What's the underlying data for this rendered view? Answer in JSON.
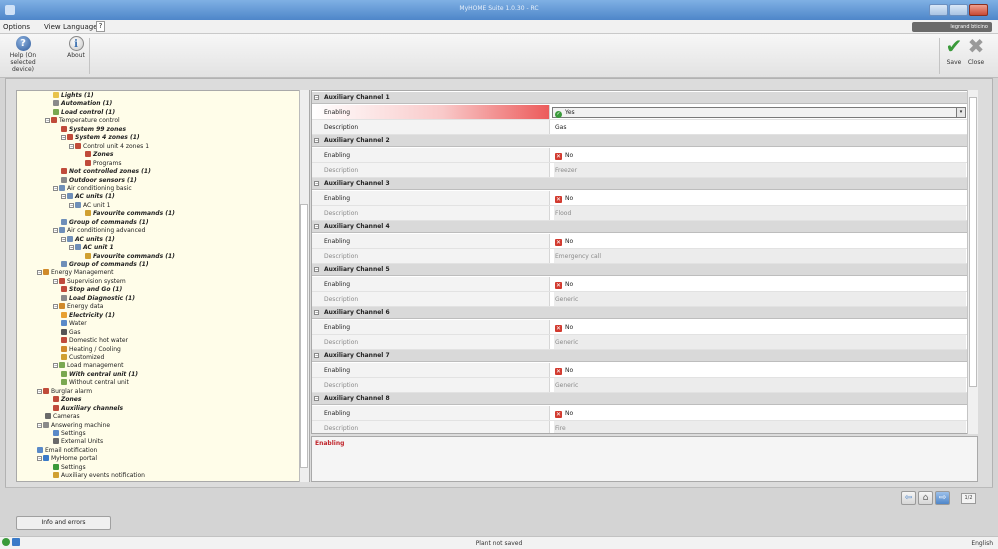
{
  "window": {
    "title": "MyHOME Suite 1.0.30 - RC"
  },
  "menu": {
    "items": [
      "Options",
      "View",
      "Language"
    ],
    "help": "?"
  },
  "brand": "legrand bticino",
  "toolbar": {
    "help_label_1": "Help (On",
    "help_label_2": "selected device)",
    "about_label": "About",
    "save_label": "Save",
    "close_label": "Close"
  },
  "tree": [
    {
      "label": "Lights (1)",
      "indent": 5,
      "bold": true,
      "icon": "#e8c34a"
    },
    {
      "label": "Automation (1)",
      "indent": 5,
      "bold": true,
      "icon": "#8a8a8a"
    },
    {
      "label": "Load control (1)",
      "indent": 5,
      "bold": true,
      "icon": "#7aa850"
    },
    {
      "label": "Temperature control",
      "indent": 4,
      "bold": false,
      "icon": "#c04b3a",
      "toggle": "−"
    },
    {
      "label": "System 99 zones",
      "indent": 6,
      "bold": true,
      "icon": "#c04b3a"
    },
    {
      "label": "System 4 zones (1)",
      "indent": 6,
      "bold": true,
      "icon": "#c04b3a",
      "toggle": "−"
    },
    {
      "label": "Control unit 4 zones 1",
      "indent": 7,
      "bold": false,
      "icon": "#c04b3a",
      "toggle": "−"
    },
    {
      "label": "Zones",
      "indent": 9,
      "bold": true,
      "icon": "#c04b3a"
    },
    {
      "label": "Programs",
      "indent": 9,
      "bold": false,
      "icon": "#c04b3a"
    },
    {
      "label": "Not controlled zones (1)",
      "indent": 6,
      "bold": true,
      "icon": "#c04b3a"
    },
    {
      "label": "Outdoor sensors (1)",
      "indent": 6,
      "bold": true,
      "icon": "#8a8a8a"
    },
    {
      "label": "Air conditioning basic",
      "indent": 5,
      "bold": false,
      "icon": "#6f8fb8",
      "toggle": "−"
    },
    {
      "label": "AC units (1)",
      "indent": 6,
      "bold": true,
      "icon": "#6f8fb8",
      "toggle": "−"
    },
    {
      "label": "AC unit 1",
      "indent": 7,
      "bold": false,
      "icon": "#6f8fb8",
      "toggle": "−"
    },
    {
      "label": "Favourite commands (1)",
      "indent": 9,
      "bold": true,
      "icon": "#d0a030"
    },
    {
      "label": "Group of commands (1)",
      "indent": 6,
      "bold": true,
      "icon": "#6f8fb8"
    },
    {
      "label": "Air conditioning advanced",
      "indent": 5,
      "bold": false,
      "icon": "#6f8fb8",
      "toggle": "−"
    },
    {
      "label": "AC units (1)",
      "indent": 6,
      "bold": true,
      "icon": "#6f8fb8",
      "toggle": "−"
    },
    {
      "label": "AC unit 1",
      "indent": 7,
      "bold": true,
      "icon": "#6f8fb8",
      "toggle": "−"
    },
    {
      "label": "Favourite commands (1)",
      "indent": 9,
      "bold": true,
      "icon": "#d0a030"
    },
    {
      "label": "Group of commands (1)",
      "indent": 6,
      "bold": true,
      "icon": "#6f8fb8"
    },
    {
      "label": "Energy Management",
      "indent": 3,
      "bold": false,
      "icon": "#d08a2a",
      "toggle": "−"
    },
    {
      "label": "Supervision system",
      "indent": 5,
      "bold": false,
      "icon": "#c04b3a",
      "toggle": "−"
    },
    {
      "label": "Stop and Go (1)",
      "indent": 6,
      "bold": true,
      "icon": "#c04b3a"
    },
    {
      "label": "Load Diagnostic (1)",
      "indent": 6,
      "bold": true,
      "icon": "#8a8a8a"
    },
    {
      "label": "Energy data",
      "indent": 5,
      "bold": false,
      "icon": "#d08a2a",
      "toggle": "−"
    },
    {
      "label": "Electricity (1)",
      "indent": 6,
      "bold": true,
      "icon": "#e8a030"
    },
    {
      "label": "Water",
      "indent": 6,
      "bold": false,
      "icon": "#5a8ac8"
    },
    {
      "label": "Gas",
      "indent": 6,
      "bold": false,
      "icon": "#555555"
    },
    {
      "label": "Domestic hot water",
      "indent": 6,
      "bold": false,
      "icon": "#c04b3a"
    },
    {
      "label": "Heating / Cooling",
      "indent": 6,
      "bold": false,
      "icon": "#d08a2a"
    },
    {
      "label": "Customized",
      "indent": 6,
      "bold": false,
      "icon": "#d0a030"
    },
    {
      "label": "Load management",
      "indent": 5,
      "bold": false,
      "icon": "#7aa850",
      "toggle": "−"
    },
    {
      "label": "With central unit (1)",
      "indent": 6,
      "bold": true,
      "icon": "#7aa850"
    },
    {
      "label": "Without central unit",
      "indent": 6,
      "bold": false,
      "icon": "#7aa850"
    },
    {
      "label": "Burglar alarm",
      "indent": 3,
      "bold": false,
      "icon": "#c04b3a",
      "toggle": "−"
    },
    {
      "label": "Zones",
      "indent": 5,
      "bold": true,
      "icon": "#c04b3a"
    },
    {
      "label": "Auxiliary channels",
      "indent": 5,
      "bold": true,
      "icon": "#c04b3a"
    },
    {
      "label": "Cameras",
      "indent": 4,
      "bold": false,
      "icon": "#6a6a6a"
    },
    {
      "label": "Answering machine",
      "indent": 3,
      "bold": false,
      "icon": "#8a8a8a",
      "toggle": "−"
    },
    {
      "label": "Settings",
      "indent": 5,
      "bold": false,
      "icon": "#5a8ac8"
    },
    {
      "label": "External Units",
      "indent": 5,
      "bold": false,
      "icon": "#6a6a6a"
    },
    {
      "label": "Email notification",
      "indent": 3,
      "bold": false,
      "icon": "#5a8ac8"
    },
    {
      "label": "MyHome portal",
      "indent": 3,
      "bold": false,
      "icon": "#3a7ac8",
      "toggle": "−"
    },
    {
      "label": "Settings",
      "indent": 5,
      "bold": false,
      "icon": "#3a9a3a"
    },
    {
      "label": "Auxiliary events notification",
      "indent": 5,
      "bold": false,
      "icon": "#d0a030"
    }
  ],
  "grid": {
    "enabling_label": "Enabling",
    "description_label": "Description",
    "channels": [
      {
        "header": "Auxiliary Channel 1",
        "enabling": "Yes",
        "description": "Gas",
        "enabled": true
      },
      {
        "header": "Auxiliary Channel 2",
        "enabling": "No",
        "description": "Freezer",
        "enabled": false
      },
      {
        "header": "Auxiliary Channel 3",
        "enabling": "No",
        "description": "Flood",
        "enabled": false
      },
      {
        "header": "Auxiliary Channel 4",
        "enabling": "No",
        "description": "Emergency call",
        "enabled": false
      },
      {
        "header": "Auxiliary Channel 5",
        "enabling": "No",
        "description": "Generic",
        "enabled": false
      },
      {
        "header": "Auxiliary Channel 6",
        "enabling": "No",
        "description": "Generic",
        "enabled": false
      },
      {
        "header": "Auxiliary Channel 7",
        "enabling": "No",
        "description": "Generic",
        "enabled": false
      },
      {
        "header": "Auxiliary Channel 8",
        "enabling": "No",
        "description": "Fire",
        "enabled": false
      }
    ]
  },
  "help_pane": {
    "title": "Enabling"
  },
  "nav": {
    "page": "1/2"
  },
  "info_tab": "Info and errors",
  "status": {
    "text": "Plant not saved",
    "language": "English"
  }
}
